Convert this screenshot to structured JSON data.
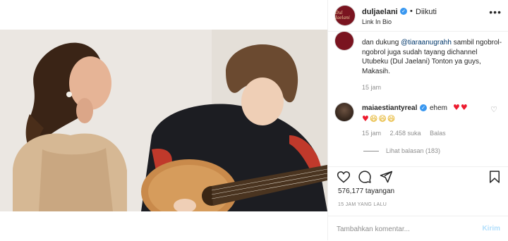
{
  "post": {
    "username": "duljaelani",
    "follow_status": "Diikuti",
    "header_sublabel": "Link In Bio",
    "caption_prefix": "dan dukung ",
    "caption_mention": "@tiaraanugrahh",
    "caption_suffix": " sambil ngobrol-ngobrol juga sudah tayang dichannel Utubeku (Dul Jaelani) Tonton ya guys, Makasih.",
    "caption_time": "15 jam",
    "avatar_text": "Dul Jaelani",
    "views": "576,177 tayangan",
    "date": "15 JAM YANG LALU"
  },
  "comment": {
    "username": "maiaestiantyreal",
    "text": "ehem",
    "emoji_line_1": "♥♥",
    "emoji_line_2_hearts": "♥",
    "emoji_line_2_smiles": "😄😄😄",
    "time": "15 jam",
    "likes": "2.458 suka",
    "reply_label": "Balas",
    "see_replies": "Lihat balasan (183)"
  },
  "composer": {
    "placeholder": "Tambahkan komentar...",
    "post_label": "Kirim"
  },
  "icons": [
    "verified-icon",
    "more-icon",
    "heart-icon",
    "comment-icon",
    "share-icon",
    "bookmark-icon",
    "like-icon"
  ],
  "colors": {
    "accent": "#3897f0",
    "heart": "#ed1b2e",
    "muted": "#8e8e8e",
    "post_disabled": "#b2dffc"
  }
}
